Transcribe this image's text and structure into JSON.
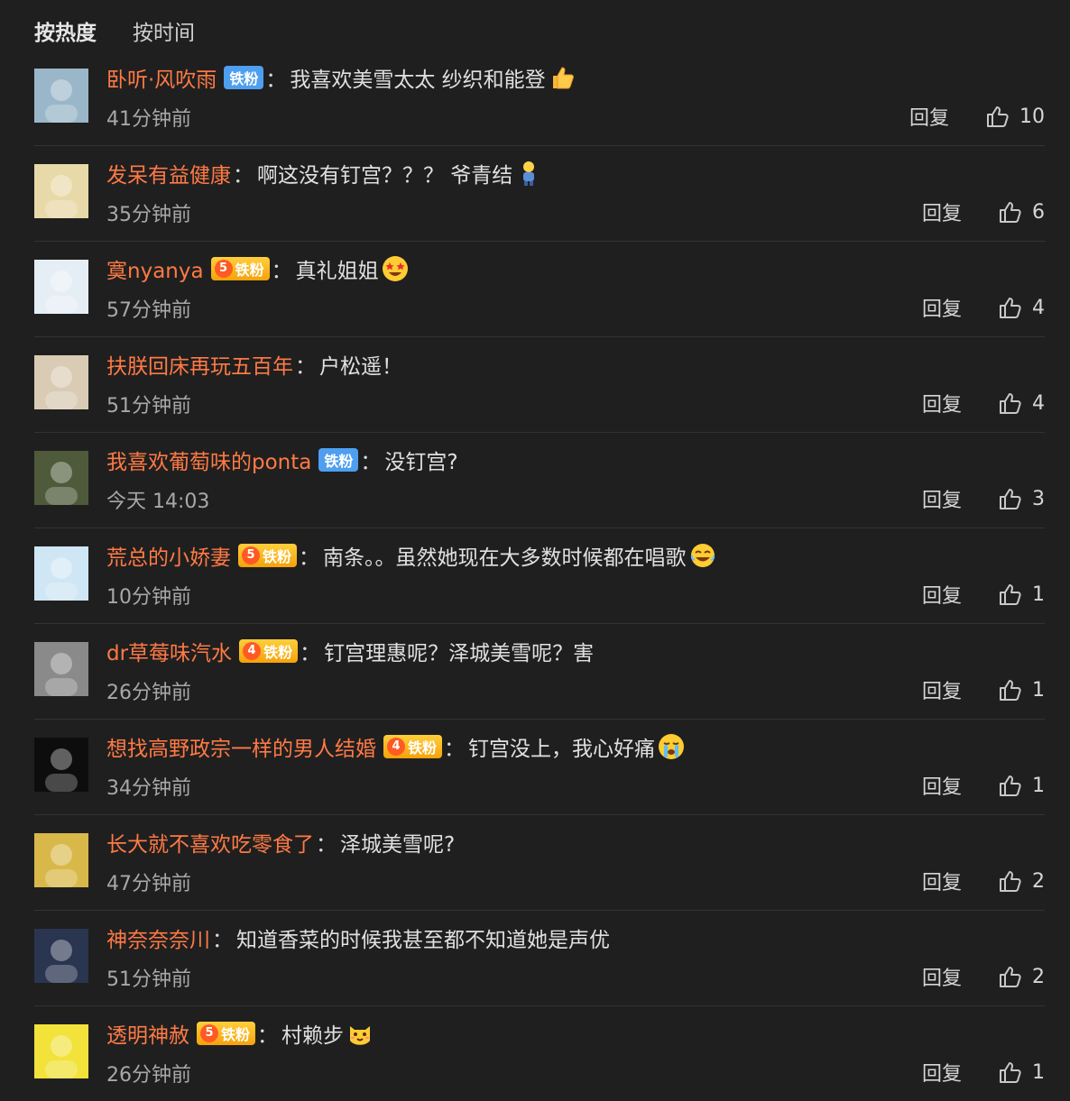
{
  "tabs": [
    "按热度",
    "按时间"
  ],
  "reply_label": "回复",
  "comments": [
    {
      "user": "卧听·风吹雨",
      "badge": "铁粉",
      "badge_type": "blue",
      "badge_level": "",
      "text": "我喜欢美雪太太 纱织和能登",
      "emoji": "thumbs-up-emoji",
      "time": "41分钟前",
      "likes": "10",
      "avatar_color": "#9ab7c9"
    },
    {
      "user": "发呆有益健康",
      "badge": "",
      "badge_type": "",
      "badge_level": "",
      "text": "啊这没有钉宫？？？ 爷青结",
      "emoji": "figure-emoji",
      "time": "35分钟前",
      "likes": "6",
      "avatar_color": "#e8d9a8"
    },
    {
      "user": "寞nyanya",
      "badge": "铁粉",
      "badge_type": "gold",
      "badge_level": "5",
      "text": "真礼姐姐",
      "emoji": "star-eyes-emoji",
      "time": "57分钟前",
      "likes": "4",
      "avatar_color": "#e6eef5"
    },
    {
      "user": "扶朕回床再玩五百年",
      "badge": "",
      "badge_type": "",
      "badge_level": "",
      "text": "户松遥！",
      "emoji": "",
      "time": "51分钟前",
      "likes": "4",
      "avatar_color": "#d9cbb4"
    },
    {
      "user": "我喜欢葡萄味的ponta",
      "badge": "铁粉",
      "badge_type": "blue",
      "badge_level": "",
      "text": "没钉宫?",
      "emoji": "",
      "time": "今天 14:03",
      "likes": "3",
      "avatar_color": "#4e5a3a"
    },
    {
      "user": "荒总的小娇妻",
      "badge": "铁粉",
      "badge_type": "gold",
      "badge_level": "5",
      "text": "南条。。虽然她现在大多数时候都在唱歌",
      "emoji": "laughing-emoji",
      "time": "10分钟前",
      "likes": "1",
      "avatar_color": "#cfe6f5"
    },
    {
      "user": "dr草莓味汽水",
      "badge": "铁粉",
      "badge_type": "gold",
      "badge_level": "4",
      "text": "钉宫理惠呢？泽城美雪呢？害",
      "emoji": "",
      "time": "26分钟前",
      "likes": "1",
      "avatar_color": "#8a8a8a"
    },
    {
      "user": "想找高野政宗一样的男人结婚",
      "badge": "铁粉",
      "badge_type": "gold",
      "badge_level": "4",
      "text": "钉宫没上，我心好痛",
      "emoji": "crying-emoji",
      "time": "34分钟前",
      "likes": "1",
      "avatar_color": "#0d0d0d"
    },
    {
      "user": "长大就不喜欢吃零食了",
      "badge": "",
      "badge_type": "",
      "badge_level": "",
      "text": "泽城美雪呢?",
      "emoji": "",
      "time": "47分钟前",
      "likes": "2",
      "avatar_color": "#d9b84a"
    },
    {
      "user": "神奈奈奈川",
      "badge": "",
      "badge_type": "",
      "badge_level": "",
      "text": "知道香菜的时候我甚至都不知道她是声优",
      "emoji": "",
      "time": "51分钟前",
      "likes": "2",
      "avatar_color": "#2a3550"
    },
    {
      "user": "透明神赦",
      "badge": "铁粉",
      "badge_type": "gold",
      "badge_level": "5",
      "text": "村赖步",
      "emoji": "cat-face-emoji",
      "time": "26分钟前",
      "likes": "1",
      "avatar_color": "#f2e23a"
    }
  ]
}
